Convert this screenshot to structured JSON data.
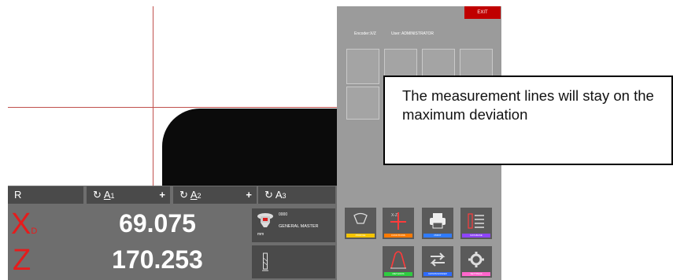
{
  "header": {
    "exit_label": "EXIT",
    "status_left": "Encoder:X/Z",
    "status_user": "User: ADMINISTRATOR"
  },
  "axes_tabs": {
    "r_label": "R",
    "a1_label": "A",
    "a1_sub": "1",
    "a2_label": "A",
    "a2_sub": "2",
    "a3_label": "A",
    "a3_sub": "3",
    "plus_symbol": "+",
    "rotate_symbol": "↻"
  },
  "readouts": {
    "x_letter": "X",
    "x_sub": "D",
    "x_value": "69.075",
    "z_letter": "Z",
    "z_value": "170.253"
  },
  "tool": {
    "number": "0000",
    "name": "GENERAL MASTER",
    "unit": "mm"
  },
  "buttons": {
    "profile": "PROFILE",
    "function": "FUNCTIONS",
    "print": "PRINT",
    "database": "DATABASE",
    "methods": "METHODS",
    "datatransfer": "DATATRANSFER",
    "settings": "SETTINGS"
  },
  "colors": {
    "profile_bar": "#f5c400",
    "function_bar": "#ff7a00",
    "print_bar": "#2f7bff",
    "database_bar": "#8e44ff",
    "methods_bar": "#2ecc40",
    "datatransfer_bar": "#2d6bff",
    "settings_bar": "#ff66cc"
  },
  "callout": {
    "text": "The measurement lines will stay on the maximum deviation"
  }
}
